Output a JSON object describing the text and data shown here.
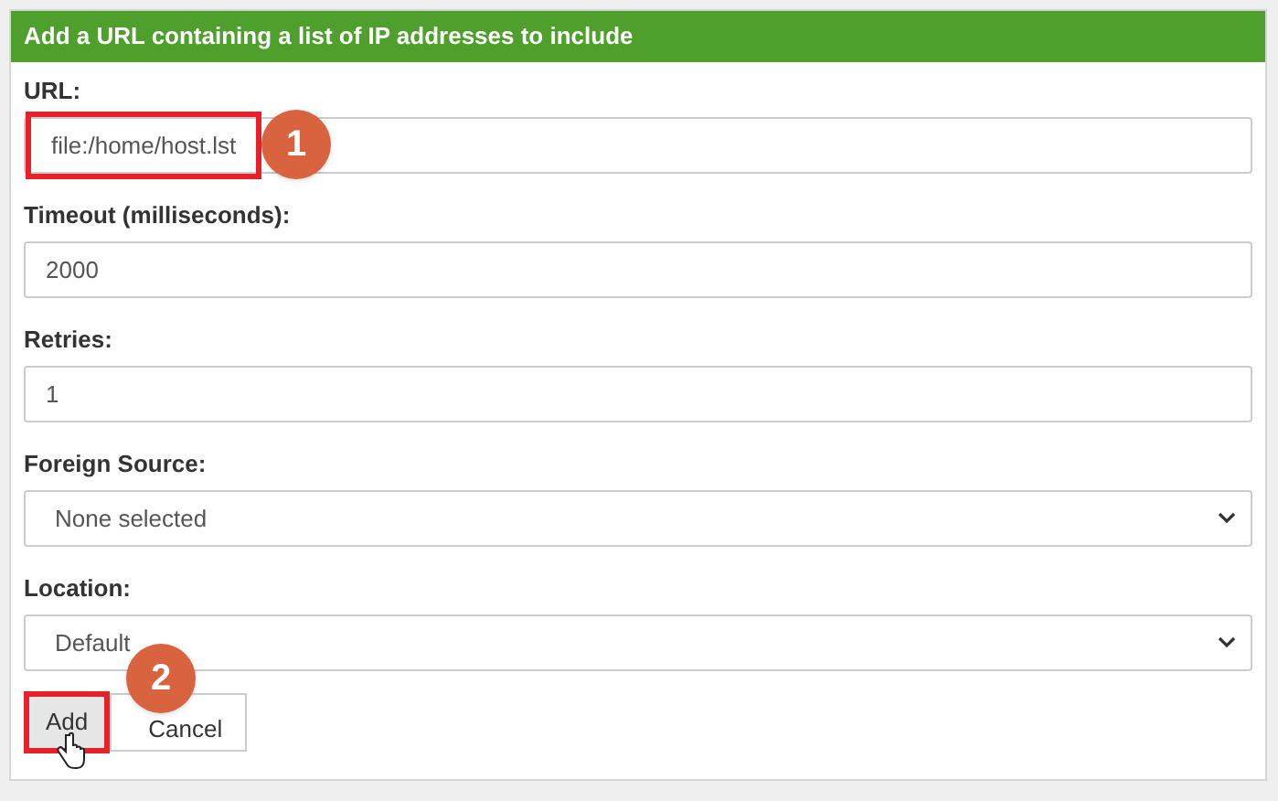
{
  "panel": {
    "title": "Add a URL containing a list of IP addresses to include"
  },
  "fields": [
    {
      "kind": "text",
      "label": "URL:",
      "value": "file:/home/host.lst",
      "highlighted": true,
      "callout": "1"
    },
    {
      "kind": "text",
      "label": "Timeout (milliseconds):",
      "value": "2000",
      "highlighted": false
    },
    {
      "kind": "text",
      "label": "Retries:",
      "value": "1",
      "highlighted": false
    },
    {
      "kind": "select",
      "label": "Foreign Source:",
      "value": "None selected",
      "highlighted": false
    },
    {
      "kind": "select",
      "label": "Location:",
      "value": "Default",
      "highlighted": false
    }
  ],
  "buttons": [
    {
      "label": "Add",
      "highlighted": true,
      "callout": "2"
    },
    {
      "label": "Cancel",
      "highlighted": false
    }
  ]
}
